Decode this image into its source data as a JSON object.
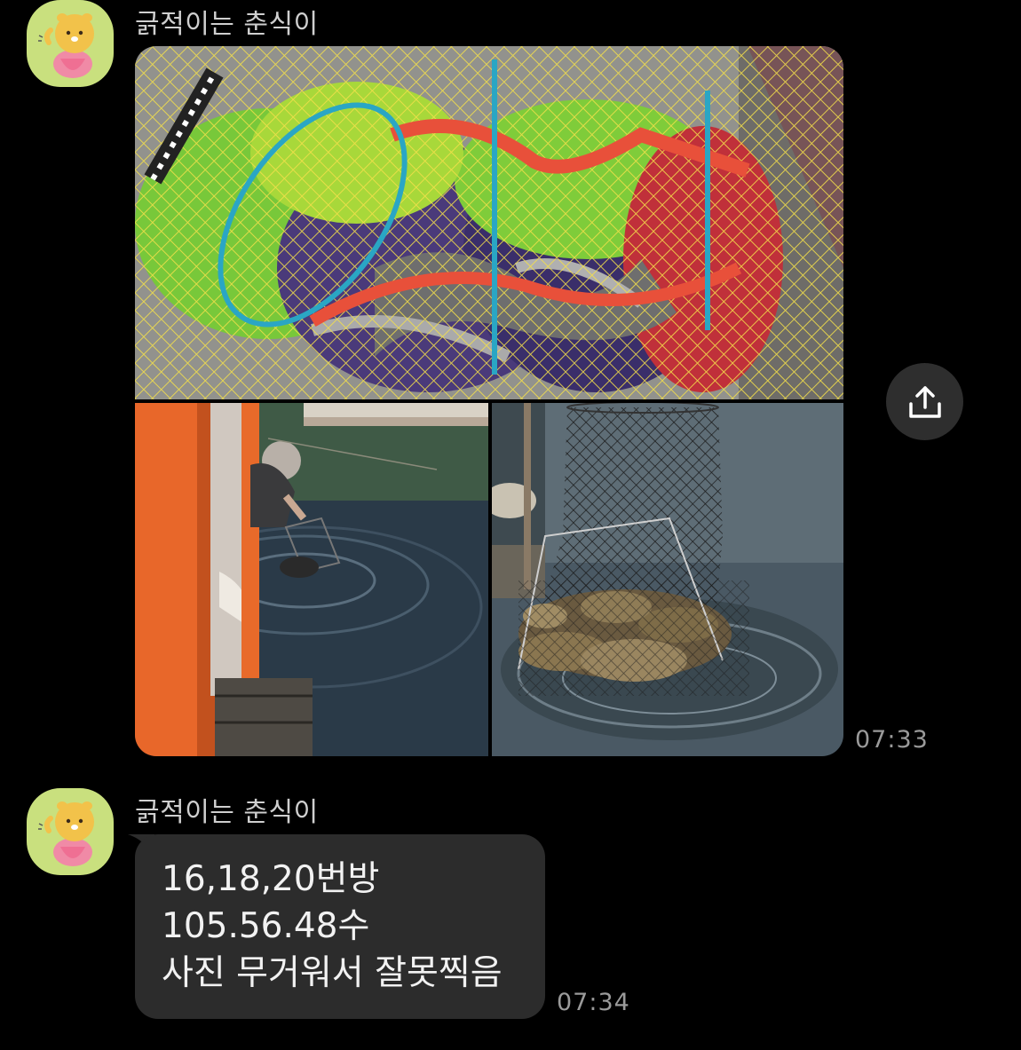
{
  "messages": [
    {
      "sender": "긁적이는 춘식이",
      "type": "photos",
      "timestamp": "07:33",
      "photos": [
        {
          "subject": "fishing-net-with-catch"
        },
        {
          "subject": "person-lifting-keepnet-from-water"
        },
        {
          "subject": "keepnet-full-of-fish-in-water"
        }
      ]
    },
    {
      "sender": "긁적이는 춘식이",
      "type": "text",
      "timestamp": "07:34",
      "lines": [
        "16,18,20번방",
        "105.56.48수",
        "사진 무거워서 잘못찍음"
      ]
    }
  ],
  "actions": {
    "share_icon": "share-upload-icon"
  },
  "colors": {
    "background": "#000000",
    "bubble": "#2c2c2c",
    "avatar_bg": "#c9e07e",
    "sender_text": "#cfcfcf",
    "timestamp_text": "#9a9a9a"
  }
}
